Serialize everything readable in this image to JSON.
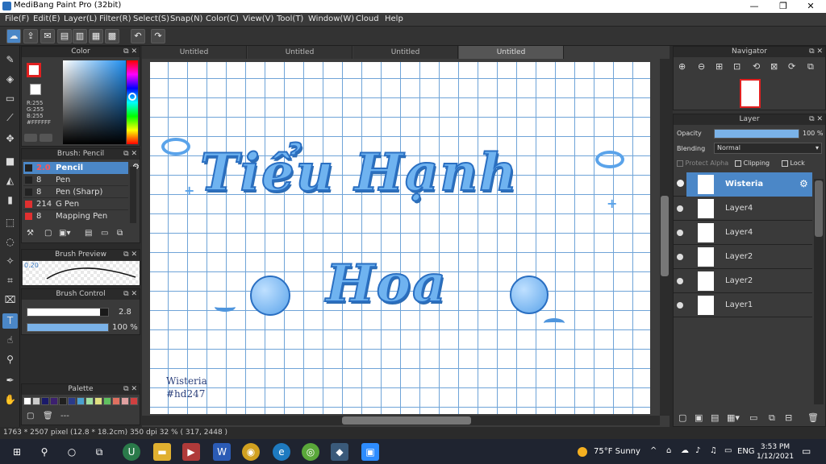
{
  "window": {
    "title": "MediBang Paint Pro (32bit)",
    "controls": [
      "—",
      "❐",
      "✕"
    ]
  },
  "menu": [
    "File(F)",
    "Edit(E)",
    "Layer(L)",
    "Filter(R)",
    "Select(S)",
    "Snap(N)",
    "Color(C)",
    "View(V)",
    "Tool(T)",
    "Window(W)",
    "Cloud",
    "Help"
  ],
  "color_panel": {
    "title": "Color",
    "r": "R:255",
    "g": "G:255",
    "b": "B:255",
    "hex": "#FFFFFF",
    "primary_color": "#e02020",
    "secondary_color": "#ffffff"
  },
  "brush_panel": {
    "title": "Brush: Pencil",
    "items": [
      {
        "size": "2.0",
        "name": "Pencil",
        "color": "#222222"
      },
      {
        "size": "8",
        "name": "Pen",
        "color": "#222222"
      },
      {
        "size": "8",
        "name": "Pen (Sharp)",
        "color": "#222222"
      },
      {
        "size": "214",
        "name": "G Pen",
        "color": "#e03030"
      },
      {
        "size": "8",
        "name": "Mapping Pen",
        "color": "#e03030"
      }
    ]
  },
  "brush_preview": {
    "title": "Brush Preview",
    "size_label": "0.20"
  },
  "brush_control": {
    "title": "Brush Control",
    "size_value": "2.8",
    "size_fraction": 0.9,
    "opacity_value": "100 %",
    "opacity_fraction": 1.0
  },
  "palette": {
    "title": "Palette",
    "swatches": [
      "#ffffff",
      "#cccccc",
      "#1a1a6a",
      "#3c2070",
      "#202020",
      "#2a3a8a",
      "#4aa0d0",
      "#a0e0a0",
      "#e0e080",
      "#60c060",
      "#e07060",
      "#e0a0a0",
      "#d04040"
    ],
    "footer": "---"
  },
  "tabs": [
    "Untitled",
    "Untitled",
    "Untitled",
    "Untitled"
  ],
  "artwork": {
    "line1": "Tiểu Hạnh",
    "line2": "Hoa",
    "signature_name": "Wisteria",
    "signature_tag": "#hd247"
  },
  "navigator": {
    "title": "Navigator"
  },
  "layer_panel": {
    "title": "Layer",
    "opacity_label": "Opacity",
    "opacity_value": "100 %",
    "opacity_fraction": 1.0,
    "blending_label": "Blending",
    "blending_value": "Normal",
    "protect_alpha": "Protect Alpha",
    "clipping": "Clipping",
    "lock": "Lock",
    "layers": [
      {
        "name": "Wisteria",
        "selected": true
      },
      {
        "name": "Layer4",
        "selected": false
      },
      {
        "name": "Layer4",
        "selected": false
      },
      {
        "name": "Layer2",
        "selected": false
      },
      {
        "name": "Layer2",
        "selected": false
      },
      {
        "name": "Layer1",
        "selected": false
      }
    ]
  },
  "status": {
    "text": "1763 * 2507 pixel   (12.8 * 18.2cm)   350 dpi   32 %   ( 317, 2448 )"
  },
  "taskbar": {
    "weather": "75°F  Sunny",
    "lang": "ENG",
    "time": "3:53 PM",
    "date": "1/12/2021"
  },
  "colors": {
    "accent": "#4b87c7",
    "lettering_fill": "#6fb3f0",
    "lettering_outline": "#2a6fc2",
    "grid": "#6fa4d8"
  }
}
